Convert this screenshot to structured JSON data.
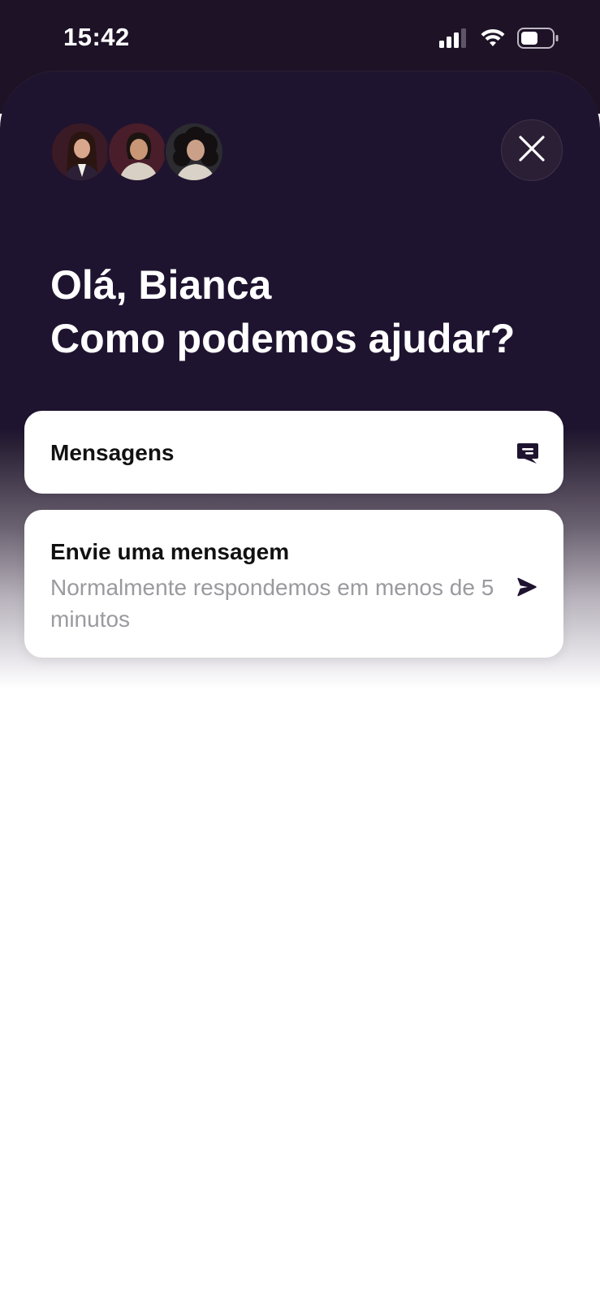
{
  "status_bar": {
    "time": "15:42",
    "icons": [
      "cellular-signal-icon",
      "wifi-icon",
      "battery-icon"
    ]
  },
  "header": {
    "avatars": [
      "agent-avatar",
      "agent-avatar",
      "agent-avatar"
    ],
    "close_icon": "close-icon"
  },
  "greeting": {
    "line1": "Olá, Bianca",
    "line2": "Como podemos ajudar?"
  },
  "cards": {
    "messages": {
      "title": "Mensagens",
      "icon": "message-icon"
    },
    "send_message": {
      "title": "Envie uma mensagem",
      "subtitle": "Normalmente respondemos em menos de 5 minutos",
      "icon": "send-arrow-icon"
    }
  },
  "colors": {
    "header_background": "#1f1430",
    "card_background": "#ffffff",
    "title_text": "#111111",
    "subtitle_text": "#9a9a9f",
    "accent_icon": "#1f1430"
  }
}
